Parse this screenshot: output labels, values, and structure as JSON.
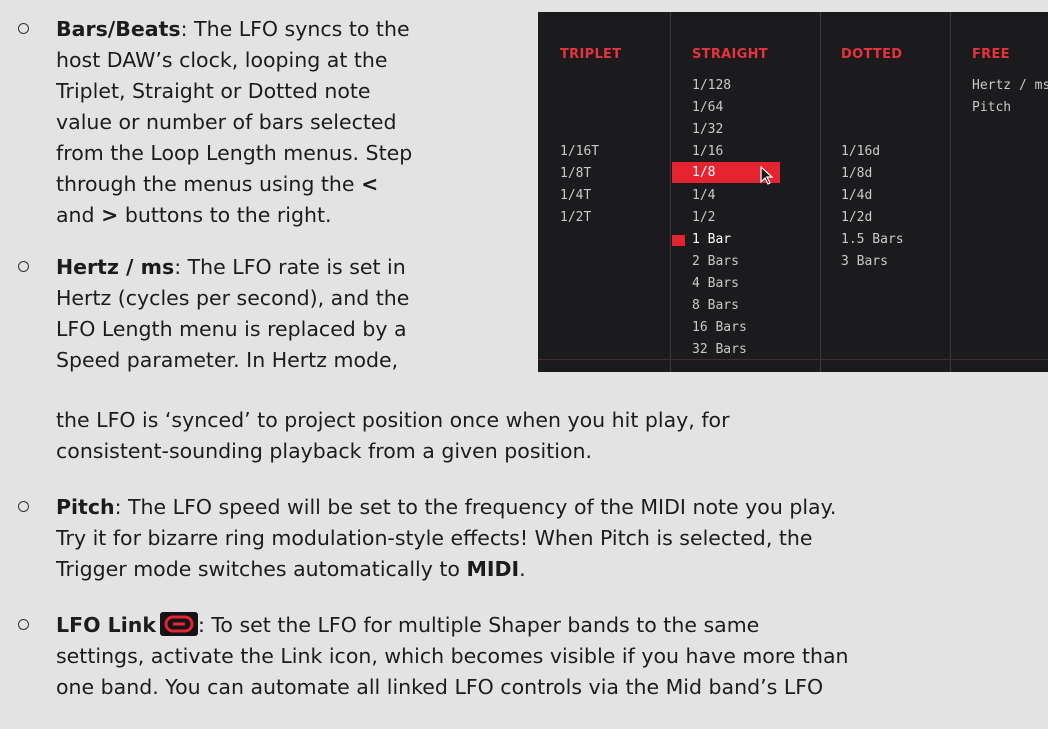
{
  "items": [
    {
      "title": "Bars/Beats",
      "lines": [
        "host DAW’s clock, looping at the",
        "Triplet, Straight or Dotted note",
        "value or number of bars selected",
        "from the Loop Length menus. Step",
        "through the menus using the"
      ],
      "first_rest": ": The LFO syncs to the",
      "lt": "<",
      "gt_and": "and",
      "gt": ">",
      "last_rest": " buttons to the right."
    },
    {
      "title": "Hertz / ms",
      "first_rest": ": The LFO rate is set in",
      "lines": [
        "Hertz (cycles per second), and the",
        "LFO Length menu is replaced by a",
        "Speed parameter. In Hertz mode,",
        "the LFO is ‘synced’ to project position once when you hit play, for",
        "consistent-sounding playback from a given position."
      ]
    },
    {
      "title": "Pitch",
      "first_rest": ": The LFO speed will be set to the frequency of the MIDI note you play.",
      "line2": "Try it for bizarre ring modulation-style effects! When Pitch is selected, the",
      "line3_pre": "Trigger mode switches automatically to ",
      "line3_bold": "MIDI",
      "line3_post": "."
    },
    {
      "title": "LFO Link",
      "icon": "link-icon",
      "first_rest": ": To set the LFO for multiple Shaper bands to the same",
      "line2": "settings, activate the Link icon, which becomes visible if you have more than",
      "line3": "one band. You can automate all linked LFO controls via the Mid band’s LFO"
    }
  ],
  "panel": {
    "headers": [
      "TRIPLET",
      "STRAIGHT",
      "DOTTED",
      "FREE"
    ],
    "triplet": [
      "1/16T",
      "1/8T",
      "1/4T",
      "1/2T"
    ],
    "straight": [
      "1/128",
      "1/64",
      "1/32",
      "1/16",
      "1/8",
      "1/4",
      "1/2",
      "1 Bar",
      "2 Bars",
      "4 Bars",
      "8 Bars",
      "16 Bars",
      "32 Bars"
    ],
    "dotted": [
      "1/16d",
      "1/8d",
      "1/4d",
      "1/2d",
      "1.5 Bars",
      "3 Bars"
    ],
    "free": [
      "Hertz / ms",
      "Pitch"
    ],
    "selected": "1/8",
    "current": "1 Bar",
    "accent": "#e5242f",
    "background": "#1b1b1d"
  }
}
